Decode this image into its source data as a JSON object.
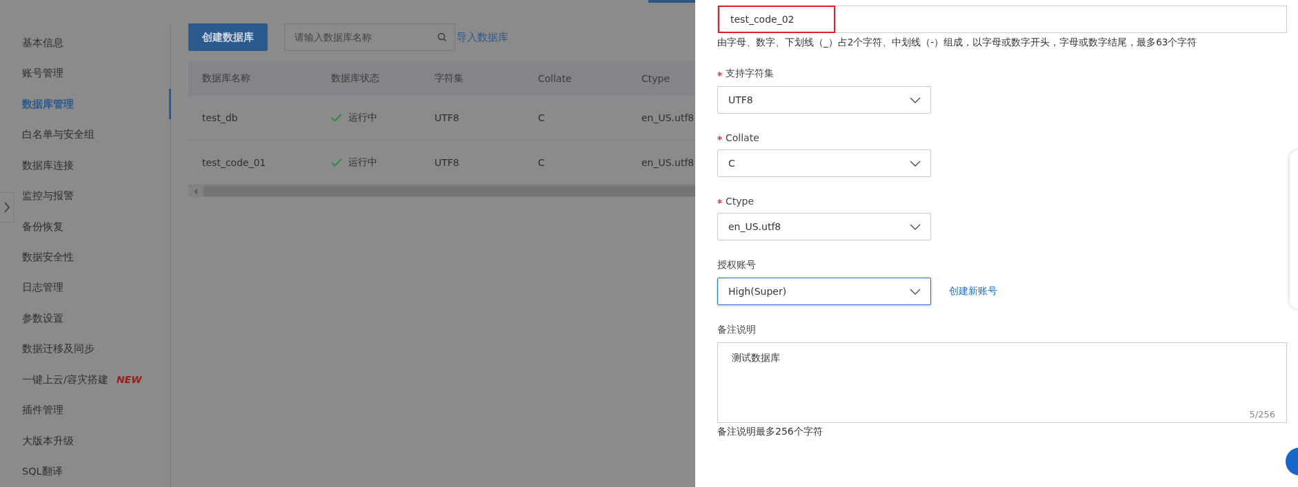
{
  "sidebar": {
    "items": [
      {
        "label": "基本信息",
        "selected": false
      },
      {
        "label": "账号管理",
        "selected": false
      },
      {
        "label": "数据库管理",
        "selected": true
      },
      {
        "label": "白名单与安全组",
        "selected": false
      },
      {
        "label": "数据库连接",
        "selected": false
      },
      {
        "label": "监控与报警",
        "selected": false
      },
      {
        "label": "备份恢复",
        "selected": false
      },
      {
        "label": "数据安全性",
        "selected": false
      },
      {
        "label": "日志管理",
        "selected": false
      },
      {
        "label": "参数设置",
        "selected": false
      },
      {
        "label": "数据迁移及同步",
        "selected": false
      },
      {
        "label": "一键上云/容灾搭建",
        "selected": false,
        "badge": "NEW"
      },
      {
        "label": "插件管理",
        "selected": false
      },
      {
        "label": "大版本升级",
        "selected": false
      },
      {
        "label": "SQL翻译",
        "selected": false
      }
    ]
  },
  "toolbar": {
    "create_button": "创建数据库",
    "search": {
      "placeholder": "请输入数据库名称"
    },
    "import_link": "导入数据库"
  },
  "table": {
    "columns": [
      "数据库名称",
      "数据库状态",
      "字符集",
      "Collate",
      "Ctype"
    ],
    "rows": [
      {
        "name": "test_db",
        "status": "运行中",
        "charset": "UTF8",
        "collate": "C",
        "ctype": "en_US.utf8"
      },
      {
        "name": "test_code_01",
        "status": "运行中",
        "charset": "UTF8",
        "collate": "C",
        "ctype": "en_US.utf8"
      }
    ]
  },
  "drawer": {
    "name_field": {
      "value": "test_code_02",
      "highlighted": true
    },
    "name_hint": "由字母、数字、下划线（_）占2个字符、中划线（-）组成，以字母或数字开头，字母或数字结尾，最多63个字符",
    "selects": [
      {
        "label": "支持字符集",
        "required": true,
        "value": "UTF8",
        "focused": false
      },
      {
        "label": "Collate",
        "required": true,
        "value": "C",
        "focused": false
      },
      {
        "label": "Ctype",
        "required": true,
        "value": "en_US.utf8",
        "focused": false
      },
      {
        "label": "授权账号",
        "required": false,
        "value": "High(Super)",
        "focused": true,
        "link": "创建新账号"
      }
    ],
    "remark": {
      "label": "备注说明",
      "value": "测试数据库",
      "counter": "5/256",
      "hint": "备注说明最多256个字符"
    }
  }
}
